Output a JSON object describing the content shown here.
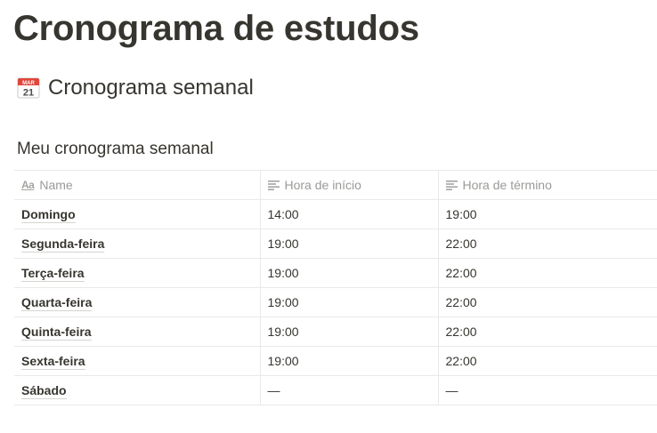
{
  "page": {
    "title": "Cronograma de estudos"
  },
  "section": {
    "icon": "calendar-icon",
    "icon_month": "MAR",
    "icon_day": "21",
    "heading": "Cronograma semanal"
  },
  "database": {
    "title": "Meu cronograma semanal",
    "columns": [
      {
        "label": "Name",
        "icon": "text-aa-icon"
      },
      {
        "label": "Hora de início",
        "icon": "text-lines-icon"
      },
      {
        "label": "Hora de término",
        "icon": "text-lines-icon"
      }
    ],
    "rows": [
      {
        "name": "Domingo",
        "start": "14:00",
        "end": "19:00"
      },
      {
        "name": "Segunda-feira",
        "start": "19:00",
        "end": "22:00"
      },
      {
        "name": "Terça-feira",
        "start": "19:00",
        "end": "22:00"
      },
      {
        "name": "Quarta-feira",
        "start": "19:00",
        "end": "22:00"
      },
      {
        "name": "Quinta-feira",
        "start": "19:00",
        "end": "22:00"
      },
      {
        "name": "Sexta-feira",
        "start": "19:00",
        "end": "22:00"
      },
      {
        "name": "Sábado",
        "start": "—",
        "end": "—"
      }
    ]
  }
}
